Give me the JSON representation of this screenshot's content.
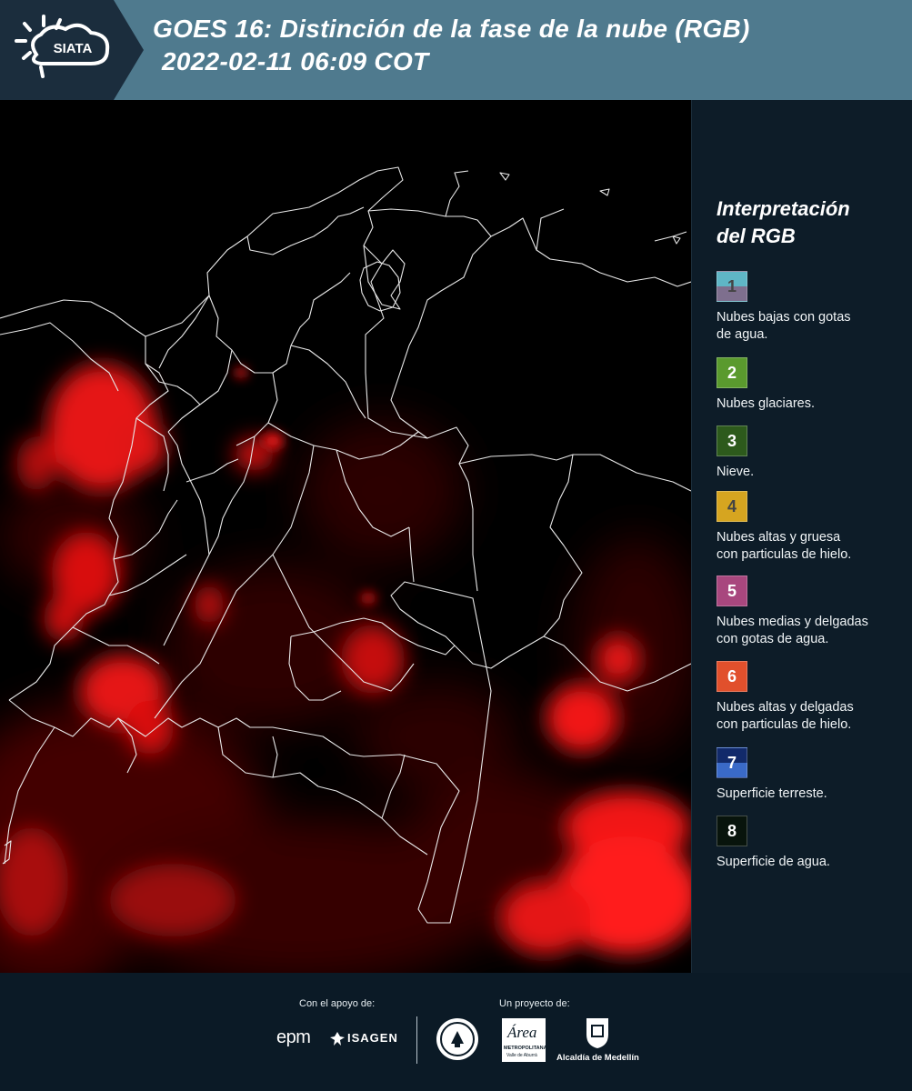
{
  "header": {
    "logo_text": "SIATA",
    "title_line1": "GOES 16: Distinción de la fase de la nube (RGB)",
    "title_line2": "2022-02-11 06:09 COT"
  },
  "legend": {
    "title": "Interpretación\ndel RGB",
    "items": [
      {
        "num": "1",
        "label": "Nubes bajas con gotas\nde agua.",
        "top_color": "#5fb6c6",
        "bottom_color": "#7e6f8e",
        "num_color": "#444444"
      },
      {
        "num": "2",
        "label": "Nubes glaciares.",
        "top_color": "#5a9a2e",
        "bottom_color": "#5a9a2e",
        "num_color": "#ffffff"
      },
      {
        "num": "3",
        "label": "Nieve.",
        "top_color": "#2d5a1c",
        "bottom_color": "#2d5a1c",
        "num_color": "#ffffff"
      },
      {
        "num": "4",
        "label": "Nubes altas y gruesa\ncon particulas de hielo.",
        "top_color": "#d6a520",
        "bottom_color": "#d6a520",
        "num_color": "#444444"
      },
      {
        "num": "5",
        "label": "Nubes medias y delgadas\ncon gotas de agua.",
        "top_color": "#a8477e",
        "bottom_color": "#a8477e",
        "num_color": "#ffffff"
      },
      {
        "num": "6",
        "label": "Nubes altas y delgadas\ncon particulas de hielo.",
        "top_color": "#e1502c",
        "bottom_color": "#e1502c",
        "num_color": "#ffffff"
      },
      {
        "num": "7",
        "label": "Superficie terreste.",
        "top_color": "#122a6a",
        "bottom_color": "#3a6ac8",
        "num_color": "#ffffff"
      },
      {
        "num": "8",
        "label": "Superficie de agua.",
        "top_color": "#08140c",
        "bottom_color": "#08140c",
        "num_color": "#ffffff"
      }
    ]
  },
  "footer": {
    "support_label": "Con el apoyo de:",
    "project_label": "Un proyecto de:",
    "logos": {
      "epm": "epm",
      "isagen": "ISAGEN",
      "area_main": "Área",
      "area_sub": "METROPOLITANA",
      "area_sub2": "Valle de Aburrá",
      "alcaldia": "Alcaldía de Medellín"
    }
  }
}
